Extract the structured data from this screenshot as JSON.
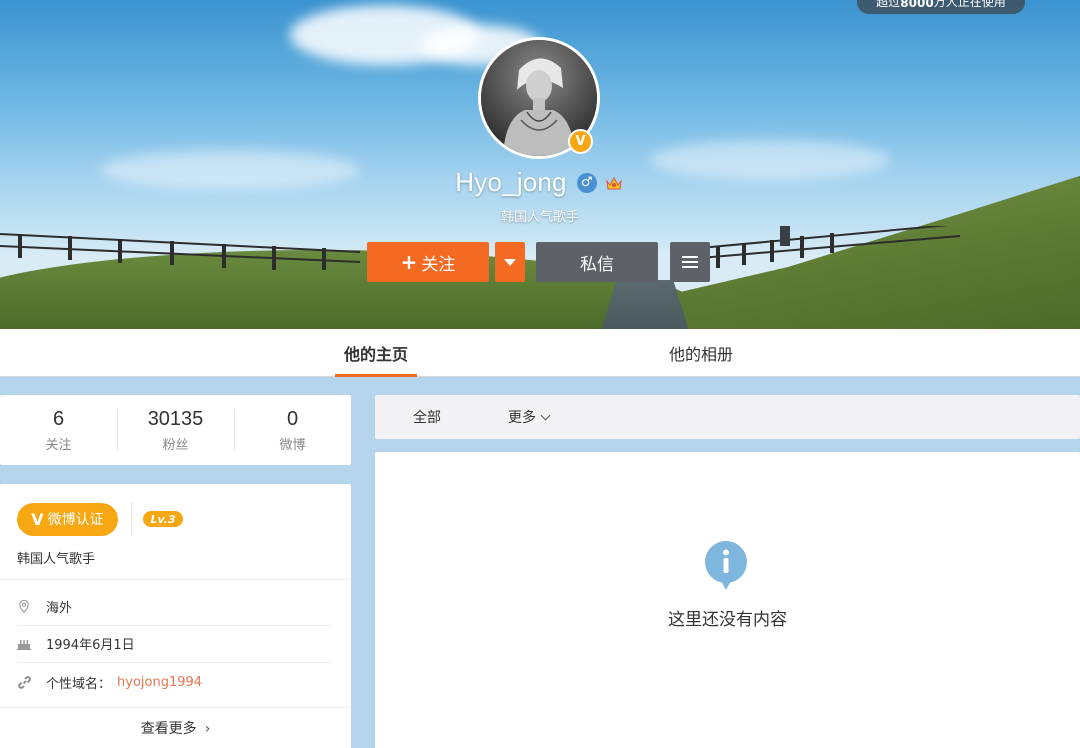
{
  "top_badge": {
    "prefix": "超过",
    "number": "8000",
    "suffix": "万人正在使用"
  },
  "profile": {
    "username": "Hyo_jong",
    "bio": "韩国人气歌手",
    "verified_badge": "V",
    "gender_icon": "male-icon",
    "gender_glyph": "♂"
  },
  "actions": {
    "follow_plus": "+",
    "follow_label": "关注",
    "message_label": "私信"
  },
  "tabs": [
    {
      "label": "他的主页",
      "active": true
    },
    {
      "label": "他的相册",
      "active": false
    }
  ],
  "stats": [
    {
      "value": "6",
      "label": "关注"
    },
    {
      "value": "30135",
      "label": "粉丝"
    },
    {
      "value": "0",
      "label": "微博"
    }
  ],
  "info": {
    "verify_v": "V",
    "verify_label": "微博认证",
    "level": "Lv.3",
    "bio": "韩国人气歌手",
    "location": "海外",
    "birthday": "1994年6月1日",
    "domain_label": "个性域名：",
    "domain_value": "hyojong1994",
    "see_more": "查看更多",
    "see_more_chevron": "›"
  },
  "filter": {
    "all_label": "全部",
    "more_label": "更多"
  },
  "empty_state": {
    "icon": "info-icon",
    "text": "这里还没有内容"
  },
  "colors": {
    "accent": "#f56a22",
    "verify": "#f7a712",
    "dark_button": "#5d6168",
    "link": "#eb7350",
    "page_bg": "#b3d4eb"
  }
}
